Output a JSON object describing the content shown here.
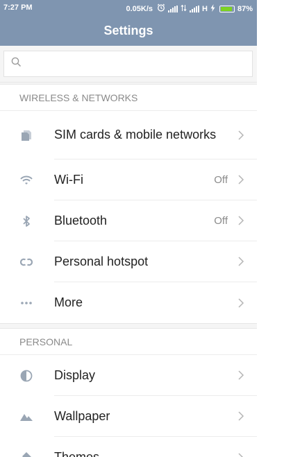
{
  "status": {
    "time": "7:27 PM",
    "net_speed": "0.05K/s",
    "network_type": "H",
    "battery": "87%",
    "battery_level": 0.87
  },
  "header": {
    "title": "Settings"
  },
  "search": {
    "placeholder": "",
    "value": ""
  },
  "sections": {
    "wireless": {
      "title": "WIRELESS & NETWORKS",
      "items": {
        "sim": {
          "label": "SIM cards & mobile networks",
          "icon": "sim-card-icon"
        },
        "wifi": {
          "label": "Wi-Fi",
          "value": "Off",
          "icon": "wifi-icon"
        },
        "bluetooth": {
          "label": "Bluetooth",
          "value": "Off",
          "icon": "bluetooth-icon"
        },
        "hotspot": {
          "label": "Personal hotspot",
          "icon": "hotspot-icon"
        },
        "more": {
          "label": "More",
          "icon": "more-dots-icon"
        }
      }
    },
    "personal": {
      "title": "PERSONAL",
      "items": {
        "display": {
          "label": "Display",
          "icon": "display-icon"
        },
        "wallpaper": {
          "label": "Wallpaper",
          "icon": "wallpaper-icon"
        },
        "themes": {
          "label": "Themes",
          "icon": "themes-icon"
        }
      }
    }
  },
  "colors": {
    "header_bg": "#7f95b0",
    "icon": "#9aa6b4",
    "battery_fill": "#7ed321"
  }
}
